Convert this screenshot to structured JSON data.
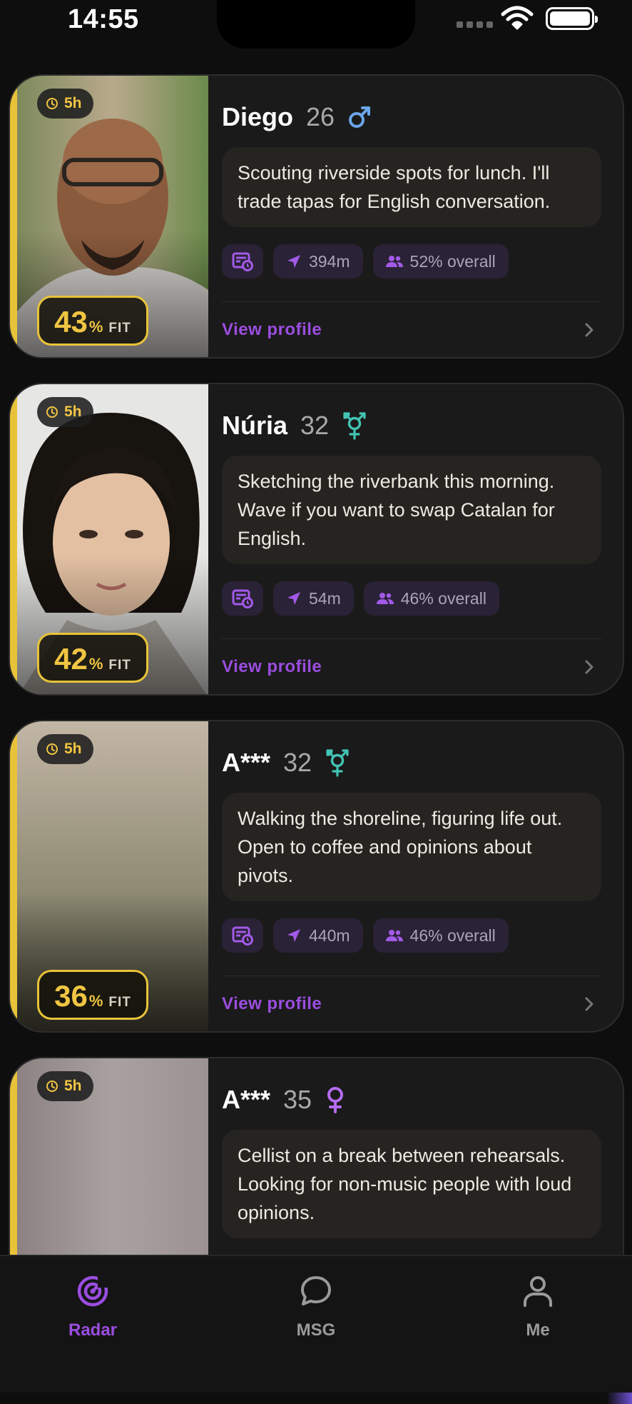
{
  "status_bar": {
    "time": "14:55"
  },
  "cards": [
    {
      "name": "Diego",
      "age": "26",
      "gender": "male",
      "time_ago": "5h",
      "fit_value": "43",
      "fit_unit": "%",
      "fit_label": "FIT",
      "bio": "Scouting riverside spots for lunch. I'll trade tapas for English conversation.",
      "distance": "394m",
      "overall": "52% overall",
      "view_profile": "View profile"
    },
    {
      "name": "Núria",
      "age": "32",
      "gender": "transgender",
      "time_ago": "5h",
      "fit_value": "42",
      "fit_unit": "%",
      "fit_label": "FIT",
      "bio": "Sketching the riverbank this morning. Wave if you want to swap Catalan for English.",
      "distance": "54m",
      "overall": "46% overall",
      "view_profile": "View profile"
    },
    {
      "name": "A***",
      "age": "32",
      "gender": "transgender",
      "time_ago": "5h",
      "fit_value": "36",
      "fit_unit": "%",
      "fit_label": "FIT",
      "bio": "Walking the shoreline, figuring life out. Open to coffee and opinions about pivots.",
      "distance": "440m",
      "overall": "46% overall",
      "view_profile": "View profile"
    },
    {
      "name": "A***",
      "age": "35",
      "gender": "female",
      "time_ago": "5h",
      "bio": "Cellist on a break between rehearsals. Looking for non-music people with loud opinions."
    }
  ],
  "tabs": [
    {
      "label": "Radar",
      "icon": "radar-icon",
      "active": true
    },
    {
      "label": "MSG",
      "icon": "chat-bubble-icon",
      "active": false
    },
    {
      "label": "Me",
      "icon": "person-icon",
      "active": false
    }
  ],
  "colors": {
    "accent_gold": "#f0c542",
    "accent_purple": "#9b4de0",
    "male_blue": "#6aa6e8",
    "trans_teal": "#43c4b4",
    "female_purple": "#b46cf0"
  }
}
